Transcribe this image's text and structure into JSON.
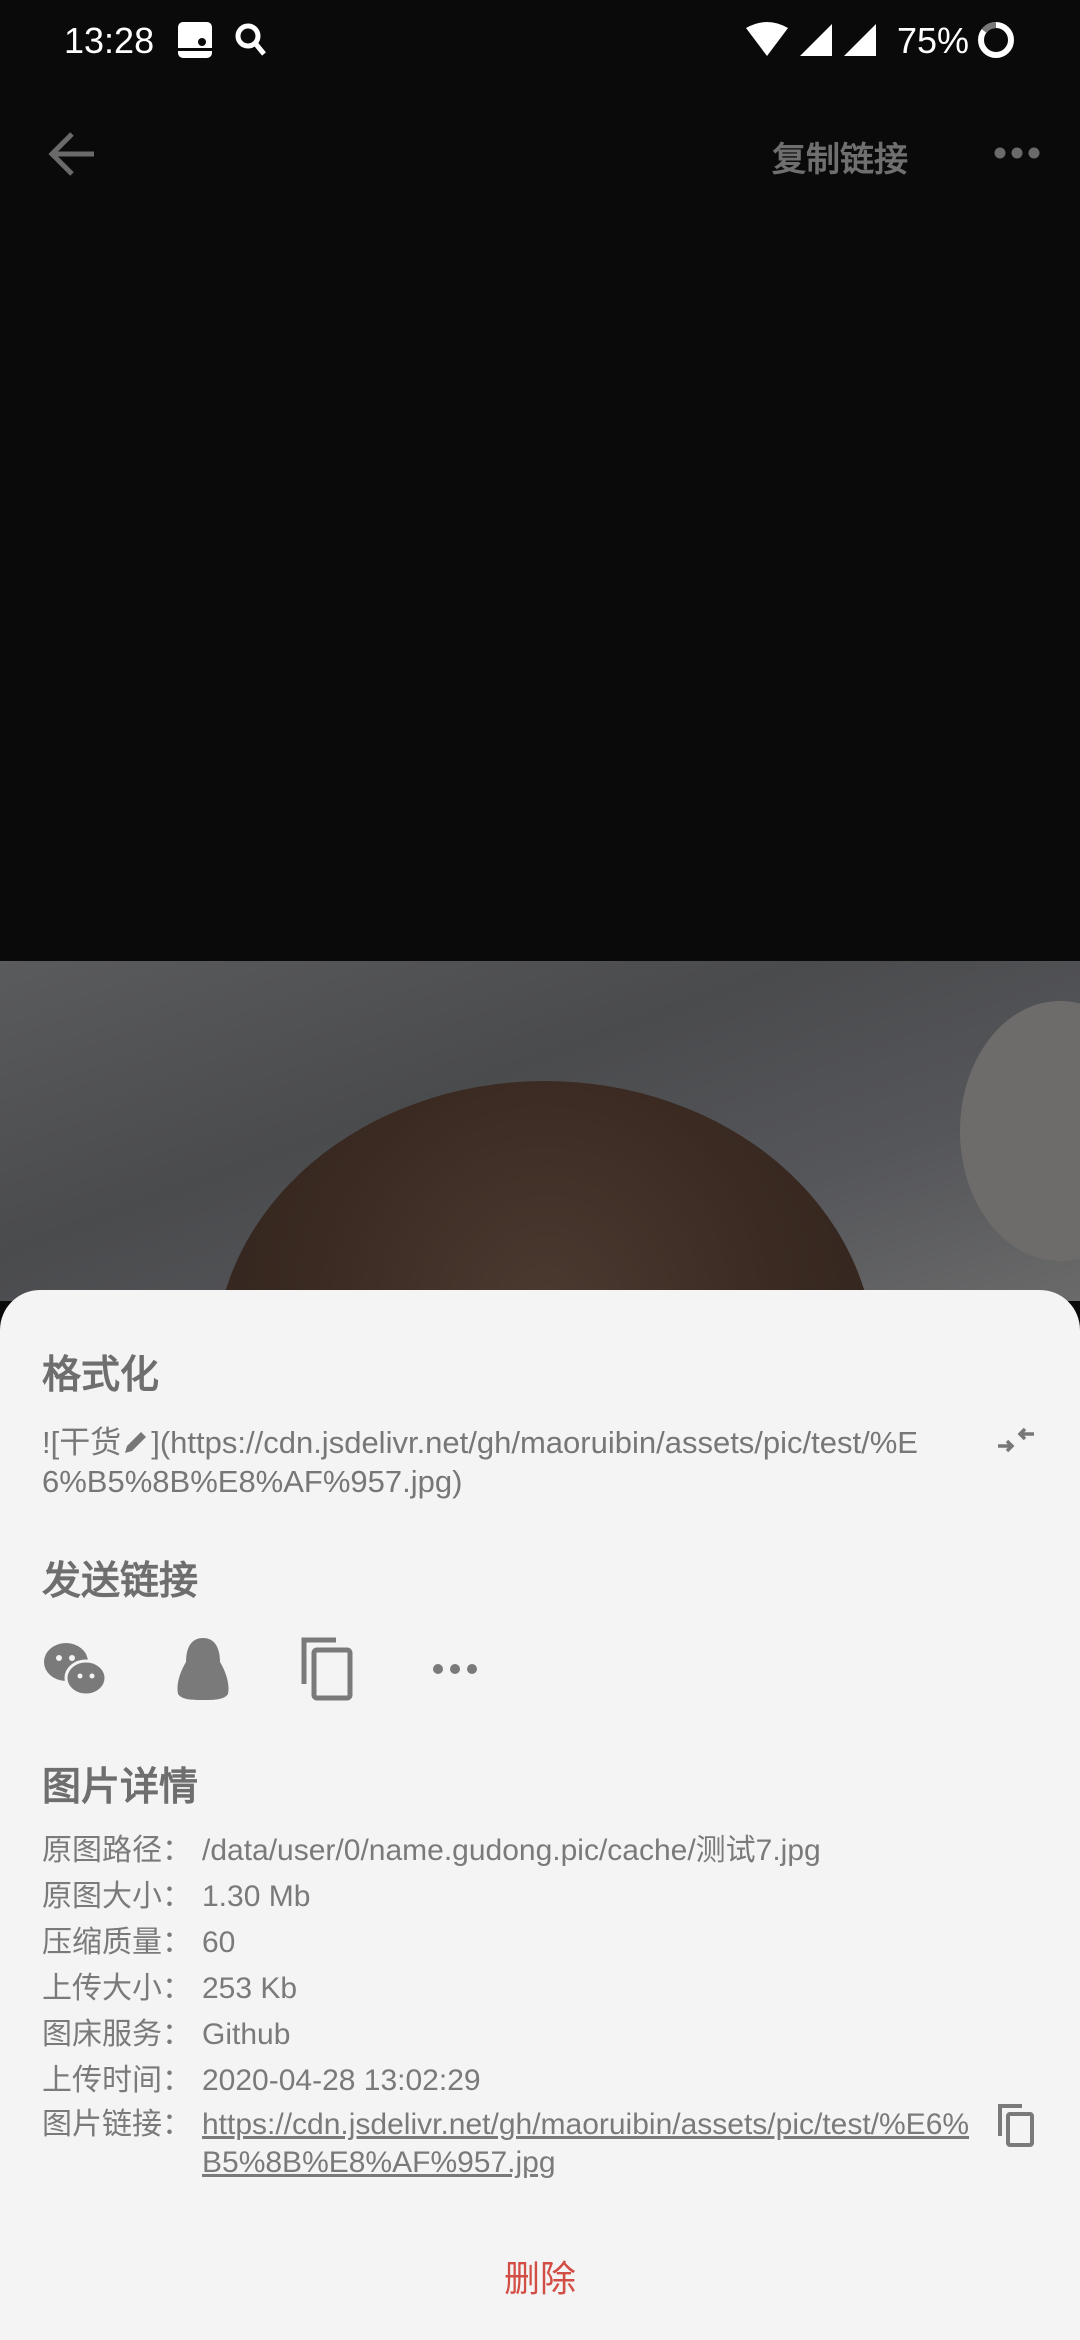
{
  "status_bar": {
    "time": "13:28",
    "battery": "75%"
  },
  "toolbar": {
    "copy_link": "复制链接"
  },
  "format": {
    "heading": "格式化",
    "text_prefix": "![干货",
    "text_suffix": "](https://cdn.jsdelivr.net/gh/maoruibin/assets/pic/test/%E6%B5%8B%E8%AF%957.jpg)"
  },
  "share": {
    "heading": "发送链接",
    "targets": [
      "wechat",
      "qq",
      "copy",
      "more"
    ]
  },
  "details": {
    "heading": "图片详情",
    "rows": [
      {
        "label": "原图路径：",
        "value": "/data/user/0/name.gudong.pic/cache/测试7.jpg"
      },
      {
        "label": "原图大小：",
        "value": "1.30 Mb"
      },
      {
        "label": "压缩质量：",
        "value": "60"
      },
      {
        "label": "上传大小：",
        "value": "253 Kb"
      },
      {
        "label": "图床服务：",
        "value": "Github"
      },
      {
        "label": "上传时间：",
        "value": "2020-04-28 13:02:29"
      },
      {
        "label": "图片链接：",
        "value": "https://cdn.jsdelivr.net/gh/maoruibin/assets/pic/test/%E6%B5%8B%E8%AF%957.jpg"
      }
    ]
  },
  "delete_label": "删除",
  "colors": {
    "delete": "#d24d44",
    "sheet": "#f4f4f4",
    "background": "#0a0a0a"
  }
}
